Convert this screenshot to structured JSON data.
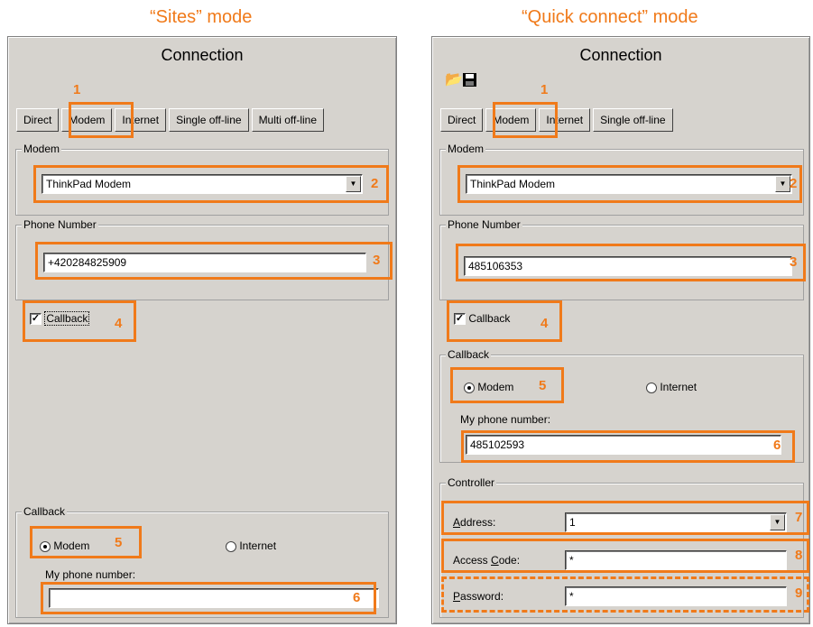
{
  "left": {
    "mode_title": "“Sites” mode",
    "panel_title": "Connection",
    "tabs": [
      {
        "label": "Direct"
      },
      {
        "label": "Modem"
      },
      {
        "label": "Internet"
      },
      {
        "label": "Single off-line"
      },
      {
        "label": "Multi off-line"
      }
    ],
    "active_tab": "Modem",
    "modem_group": {
      "legend": "Modem",
      "value": "ThinkPad Modem"
    },
    "phone_group": {
      "legend": "Phone Number",
      "value": "+420284825909"
    },
    "callback_checkbox": {
      "label": "Callback",
      "checked": true
    },
    "callback_group": {
      "legend": "Callback",
      "option_modem": "Modem",
      "option_internet": "Internet",
      "selected": "Modem",
      "my_phone_label": "My phone number:",
      "my_phone_value": ""
    },
    "markers": [
      "1",
      "2",
      "3",
      "4",
      "5",
      "6"
    ]
  },
  "right": {
    "mode_title": "“Quick connect” mode",
    "panel_title": "Connection",
    "toolbar": {
      "open_icon": "folder-open-icon",
      "save_icon": "floppy-disk-icon"
    },
    "tabs": [
      {
        "label": "Direct"
      },
      {
        "label": "Modem"
      },
      {
        "label": "Internet"
      },
      {
        "label": "Single off-line"
      }
    ],
    "active_tab": "Modem",
    "modem_group": {
      "legend": "Modem",
      "value": "ThinkPad Modem"
    },
    "phone_group": {
      "legend": "Phone Number",
      "value": "485106353"
    },
    "callback_checkbox": {
      "label": "Callback",
      "checked": true
    },
    "callback_group": {
      "legend": "Callback",
      "option_modem": "Modem",
      "option_internet": "Internet",
      "selected": "Modem",
      "my_phone_label": "My phone number:",
      "my_phone_value": "485102593"
    },
    "controller_group": {
      "legend": "Controller",
      "address_label_a": "A",
      "address_label_rest": "ddress:",
      "address_value": "1",
      "access_label_a": "Access ",
      "access_label_u": "C",
      "access_label_rest": "ode:",
      "access_value": "*",
      "password_label_u": "P",
      "password_label_rest": "assword:",
      "password_value": "*"
    },
    "markers": [
      "1",
      "2",
      "3",
      "4",
      "5",
      "6",
      "7",
      "8",
      "9"
    ]
  },
  "colors": {
    "accent": "#f07a1a",
    "panel_bg": "#d6d3ce"
  }
}
